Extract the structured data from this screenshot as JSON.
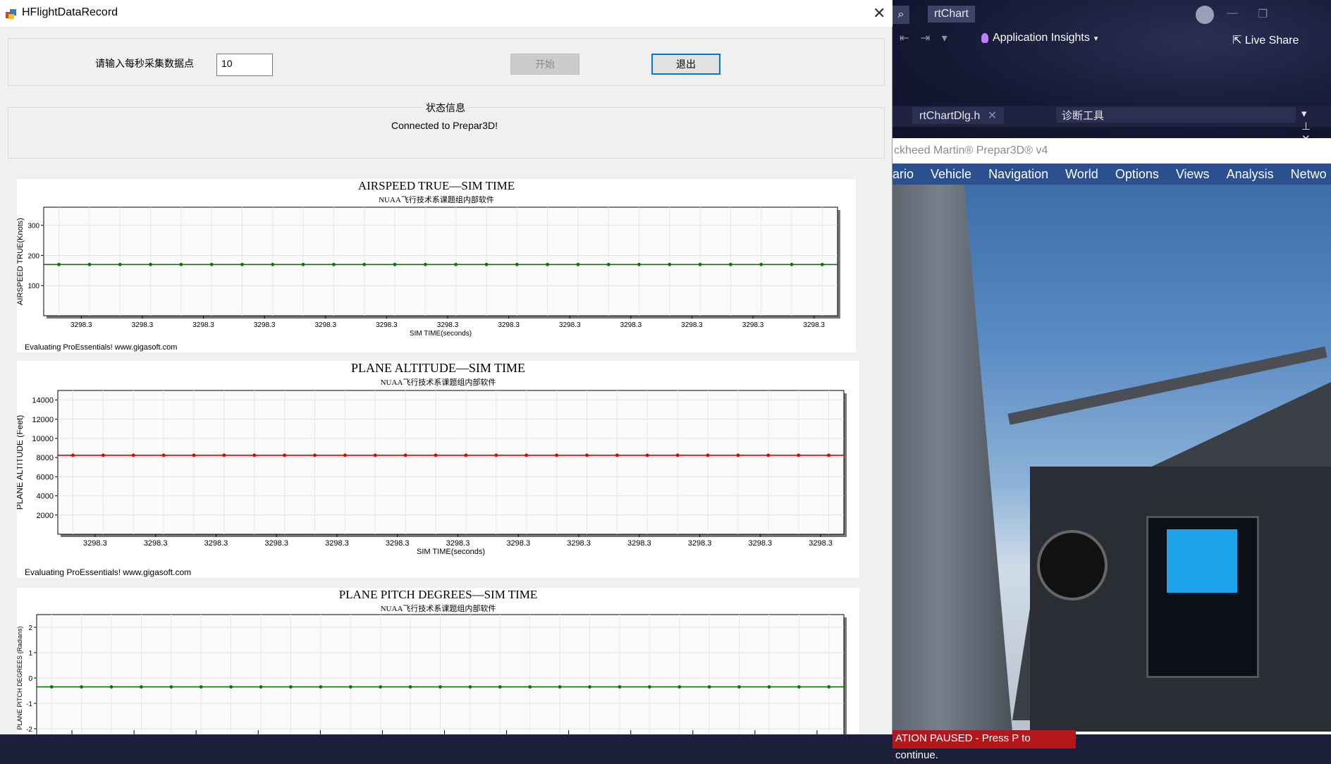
{
  "window": {
    "title": "HFlightDataRecord",
    "close_glyph": "✕"
  },
  "controls": {
    "prompt_label": "请输入每秒采集数据点",
    "points_value": "10",
    "start_label": "开始",
    "exit_label": "退出"
  },
  "status": {
    "group_label": "状态信息",
    "message": "Connected to Prepar3D!"
  },
  "charts": [
    {
      "title": "AIRSPEED TRUE—SIM TIME",
      "subtitle": "NUAA飞行技术系课题组内部软件",
      "ylabel": "AIRSPEED TRUE(Knots)",
      "xlabel": "SIM TIME(seconds)",
      "eval_note": "Evaluating ProEssentials! www.gigasoft.com",
      "color": "#007a00"
    },
    {
      "title": "PLANE ALTITUDE—SIM TIME",
      "subtitle": "NUAA飞行技术系课题组内部软件",
      "ylabel": "PLANE ALTITUDE (Feet)",
      "xlabel": "SIM TIME(seconds)",
      "eval_note": "Evaluating ProEssentials! www.gigasoft.com",
      "color": "#e00000"
    },
    {
      "title": "PLANE PITCH DEGREES—SIM TIME",
      "subtitle": "NUAA飞行技术系课题组内部软件",
      "ylabel": "PLANE PITCH DEGREES (Radians)",
      "xlabel": "",
      "eval_note": "",
      "color": "#007a00"
    }
  ],
  "chart_data": [
    {
      "type": "line",
      "title": "AIRSPEED TRUE—SIM TIME",
      "xlabel": "SIM TIME(seconds)",
      "ylabel": "AIRSPEED TRUE(Knots)",
      "ylim": [
        0,
        360
      ],
      "yticks": [
        100,
        200,
        300
      ],
      "xticks": [
        "3298.3",
        "3298.3",
        "3298.3",
        "3298.3",
        "3298.3",
        "3298.3",
        "3298.3",
        "3298.3",
        "3298.3",
        "3298.3",
        "3298.3",
        "3298.3",
        "3298.3"
      ],
      "series": [
        {
          "values": [
            170,
            170,
            170,
            170,
            170,
            170,
            170,
            170,
            170,
            170,
            170,
            170,
            170,
            170,
            170,
            170,
            170,
            170,
            170,
            170,
            170,
            170,
            170,
            170,
            170,
            170
          ]
        }
      ],
      "grid": true
    },
    {
      "type": "line",
      "title": "PLANE ALTITUDE—SIM TIME",
      "xlabel": "SIM TIME(seconds)",
      "ylabel": "PLANE ALTITUDE (Feet)",
      "ylim": [
        0,
        15000
      ],
      "yticks": [
        2000,
        4000,
        6000,
        8000,
        10000,
        12000,
        14000
      ],
      "xticks": [
        "3298.3",
        "3298.3",
        "3298.3",
        "3298.3",
        "3298.3",
        "3298.3",
        "3298.3",
        "3298.3",
        "3298.3",
        "3298.3",
        "3298.3",
        "3298.3",
        "3298.3"
      ],
      "series": [
        {
          "values": [
            8240,
            8240,
            8240,
            8240,
            8240,
            8240,
            8240,
            8240,
            8240,
            8240,
            8240,
            8240,
            8240,
            8240,
            8240,
            8240,
            8240,
            8240,
            8240,
            8240,
            8240,
            8240,
            8240,
            8240,
            8240,
            8240
          ]
        }
      ],
      "grid": true
    },
    {
      "type": "line",
      "title": "PLANE PITCH DEGREES—SIM TIME",
      "xlabel": "",
      "ylabel": "PLANE PITCH DEGREES (Radians)",
      "ylim": [
        -2.5,
        2.5
      ],
      "yticks": [
        -2,
        -1,
        0,
        1,
        2
      ],
      "xticks": [],
      "series": [
        {
          "values": [
            -0.35,
            -0.35,
            -0.35,
            -0.35,
            -0.35,
            -0.35,
            -0.35,
            -0.35,
            -0.35,
            -0.35,
            -0.35,
            -0.35,
            -0.35,
            -0.35,
            -0.35,
            -0.35,
            -0.35,
            -0.35,
            -0.35,
            -0.35,
            -0.35,
            -0.35,
            -0.35,
            -0.35,
            -0.35,
            -0.35,
            -0.35
          ]
        }
      ],
      "grid": true
    }
  ],
  "background": {
    "vs_search_glyph": "⌕",
    "vs_tab_rtchart": "rtChart",
    "vs_app_insights": "Application Insights",
    "vs_live_share": "Live Share",
    "vs_doc_tab": "rtChartDlg.h",
    "vs_diag_tools": "诊断工具",
    "p3d_title": "ckheed Martin® Prepar3D® v4",
    "p3d_menu": [
      "ario",
      "Vehicle",
      "Navigation",
      "World",
      "Options",
      "Views",
      "Analysis",
      "Netwo"
    ],
    "pause_text": "ATION PAUSED - Press P to continue."
  }
}
